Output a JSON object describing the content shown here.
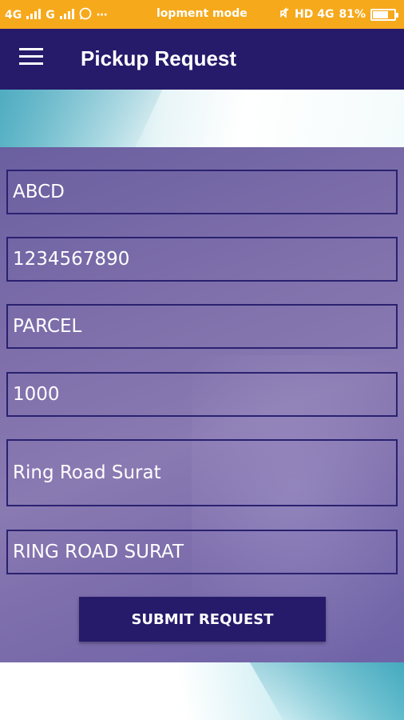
{
  "status_bar": {
    "left_text": "4G",
    "left_text_2": "G",
    "center_text": "lopment mode",
    "right_network": "HD 4G",
    "battery_percent_label": "81%",
    "battery_level": 0.81
  },
  "app_bar": {
    "title": "Pickup Request",
    "menu_icon": "hamburger-menu-icon"
  },
  "form": {
    "fields": [
      {
        "value": "ABCD"
      },
      {
        "value": "1234567890"
      },
      {
        "value": "PARCEL"
      },
      {
        "value": "1000"
      },
      {
        "value": "Ring Road Surat"
      },
      {
        "value": "RING ROAD SURAT"
      }
    ],
    "submit_label": "SUBMIT REQUEST"
  },
  "colors": {
    "status_bar": "#f6a91b",
    "app_bar": "#261a6b",
    "field_border": "#2a2170"
  }
}
